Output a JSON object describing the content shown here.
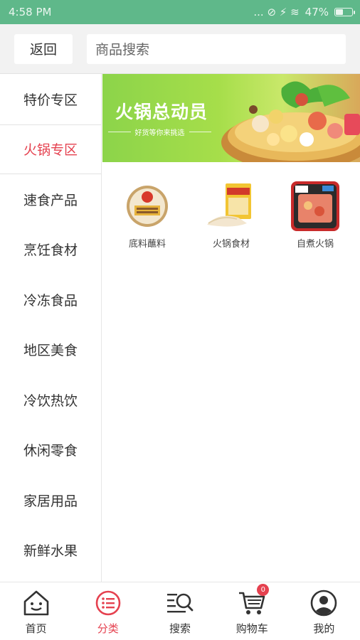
{
  "status_bar": {
    "time": "4:58 PM",
    "right_icons": "... ⊘ ⚡ ≋",
    "battery": "47%",
    "battery_level": 0.47
  },
  "header": {
    "back_label": "返回",
    "search_placeholder": "商品搜索"
  },
  "sidebar": {
    "items": [
      {
        "label": "特价专区"
      },
      {
        "label": "火锅专区"
      },
      {
        "label": "速食产品"
      },
      {
        "label": "烹饪食材"
      },
      {
        "label": "冷冻食品"
      },
      {
        "label": "地区美食"
      },
      {
        "label": "冷饮热饮"
      },
      {
        "label": "休闲零食"
      },
      {
        "label": "家居用品"
      },
      {
        "label": "新鲜水果"
      }
    ],
    "active_index": 1
  },
  "banner": {
    "title": "火锅总动员",
    "subtitle": "好货等你来挑选"
  },
  "categories": [
    {
      "label": "底料蘸料",
      "icon": "hotpot-base-icon"
    },
    {
      "label": "火锅食材",
      "icon": "hotpot-ingredient-icon"
    },
    {
      "label": "自煮火锅",
      "icon": "self-heating-hotpot-icon"
    }
  ],
  "tabbar": {
    "tabs": [
      {
        "label": "首页",
        "icon": "home-icon"
      },
      {
        "label": "分类",
        "icon": "category-icon"
      },
      {
        "label": "搜索",
        "icon": "search-icon"
      },
      {
        "label": "购物车",
        "icon": "cart-icon",
        "badge": "0"
      },
      {
        "label": "我的",
        "icon": "profile-icon"
      }
    ],
    "active_index": 1
  },
  "colors": {
    "accent": "#e5414f",
    "status_bar": "#5fb88a"
  }
}
